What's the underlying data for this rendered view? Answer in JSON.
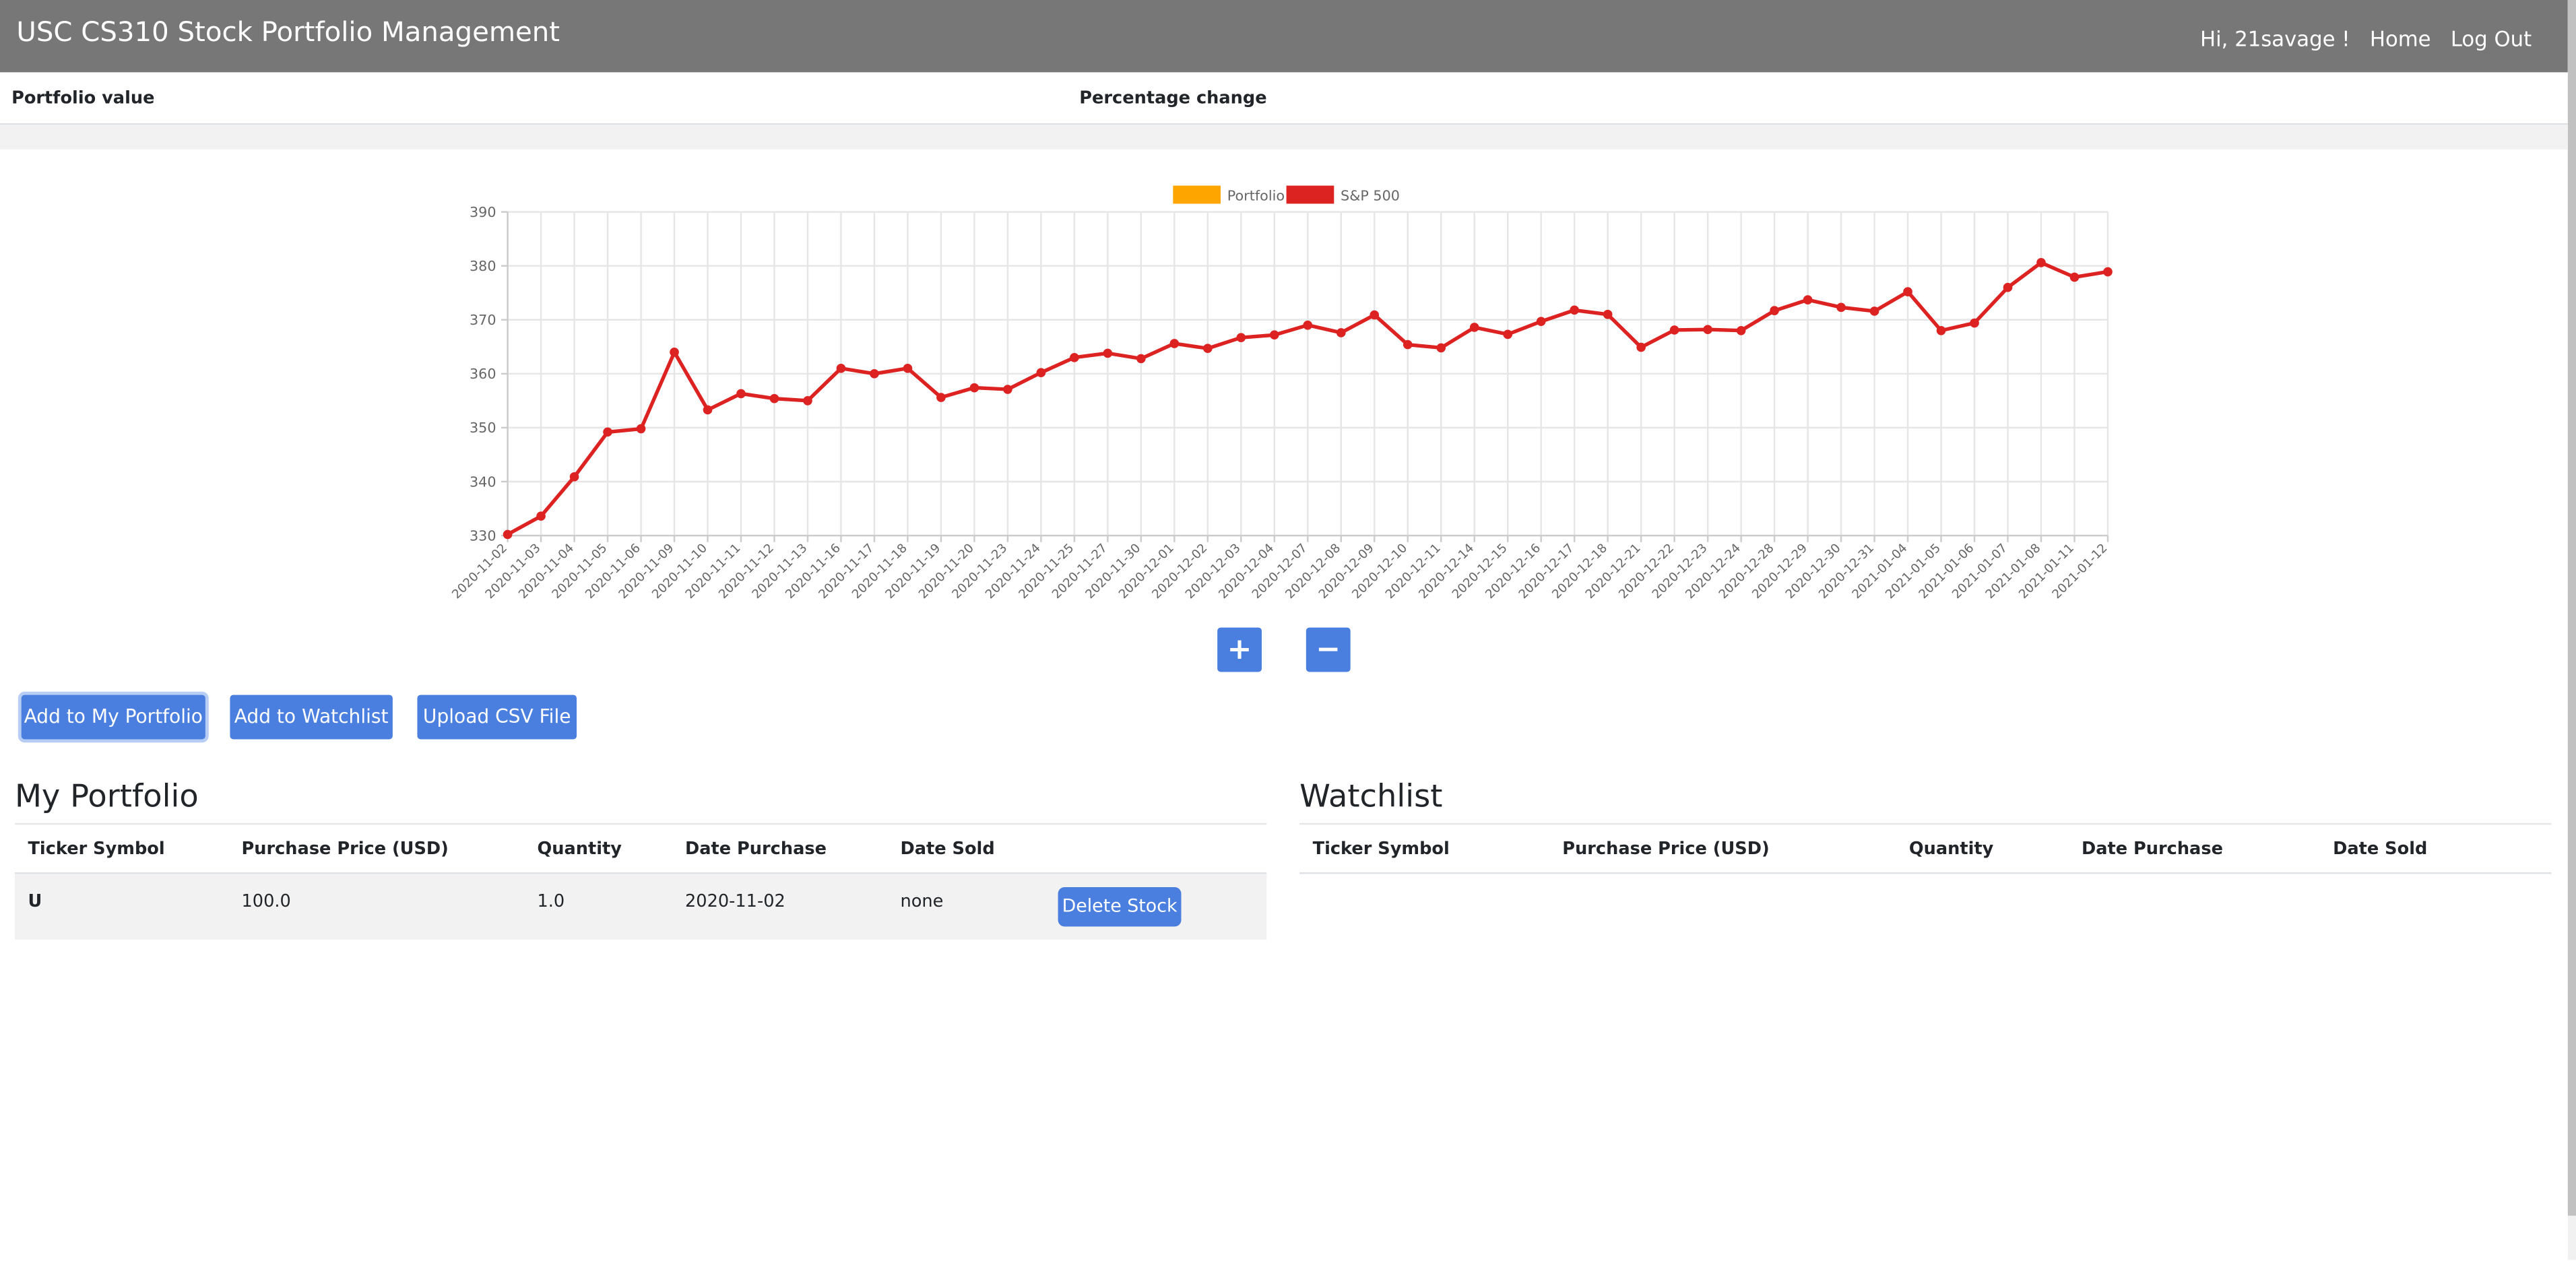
{
  "header": {
    "title": "USC CS310 Stock Portfolio Management",
    "greeting": "Hi, 21savage !",
    "home": "Home",
    "logout": "Log Out"
  },
  "summary": {
    "portfolio_value_label": "Portfolio value",
    "percentage_change_label": "Percentage change"
  },
  "colors": {
    "navbar": "#777777",
    "button": "#4a7fe0",
    "portfolio_series": "#ffa500",
    "sp500_series": "#dd2222"
  },
  "chart_data": {
    "type": "line",
    "ylim": [
      330,
      390
    ],
    "yticks": [
      330,
      340,
      350,
      360,
      370,
      380,
      390
    ],
    "grid": true,
    "legend": "top-center",
    "x": [
      "2020-11-02",
      "2020-11-03",
      "2020-11-04",
      "2020-11-05",
      "2020-11-06",
      "2020-11-09",
      "2020-11-10",
      "2020-11-11",
      "2020-11-12",
      "2020-11-13",
      "2020-11-16",
      "2020-11-17",
      "2020-11-18",
      "2020-11-19",
      "2020-11-20",
      "2020-11-23",
      "2020-11-24",
      "2020-11-25",
      "2020-11-27",
      "2020-11-30",
      "2020-12-01",
      "2020-12-02",
      "2020-12-03",
      "2020-12-04",
      "2020-12-07",
      "2020-12-08",
      "2020-12-09",
      "2020-12-10",
      "2020-12-11",
      "2020-12-14",
      "2020-12-15",
      "2020-12-16",
      "2020-12-17",
      "2020-12-18",
      "2020-12-21",
      "2020-12-22",
      "2020-12-23",
      "2020-12-24",
      "2020-12-28",
      "2020-12-29",
      "2020-12-30",
      "2020-12-31",
      "2021-01-04",
      "2021-01-05",
      "2021-01-06",
      "2021-01-07",
      "2021-01-08",
      "2021-01-11",
      "2021-01-12"
    ],
    "series": [
      {
        "name": "Portfolio",
        "color": "#ffa500",
        "values": []
      },
      {
        "name": "S&P 500",
        "color": "#dd2222",
        "values": [
          330.2,
          333.6,
          340.9,
          349.2,
          349.8,
          364.0,
          353.3,
          356.3,
          355.4,
          355.0,
          361.0,
          360.0,
          361.0,
          355.6,
          357.4,
          357.1,
          360.2,
          363.0,
          363.8,
          362.8,
          365.6,
          364.7,
          366.7,
          367.2,
          369.0,
          367.6,
          370.9,
          365.4,
          364.8,
          368.6,
          367.3,
          369.7,
          371.8,
          371.0,
          364.9,
          368.1,
          368.2,
          368.0,
          371.7,
          373.7,
          372.3,
          371.6,
          375.2,
          368.0,
          369.4,
          376.0,
          380.6,
          377.9,
          378.9
        ]
      }
    ]
  },
  "zoom": {
    "in": "+",
    "out": "−"
  },
  "actions": {
    "add_portfolio": "Add to My Portfolio",
    "add_watchlist": "Add to Watchlist",
    "upload_csv": "Upload CSV File"
  },
  "portfolio": {
    "title": "My Portfolio",
    "columns": [
      "Ticker Symbol",
      "Purchase Price (USD)",
      "Quantity",
      "Date Purchase",
      "Date Sold"
    ],
    "rows": [
      {
        "ticker": "U",
        "price": "100.0",
        "quantity": "1.0",
        "date_purchase": "2020-11-02",
        "date_sold": "none",
        "action": "Delete Stock"
      }
    ]
  },
  "watchlist": {
    "title": "Watchlist",
    "columns": [
      "Ticker Symbol",
      "Purchase Price (USD)",
      "Quantity",
      "Date Purchase",
      "Date Sold"
    ]
  }
}
